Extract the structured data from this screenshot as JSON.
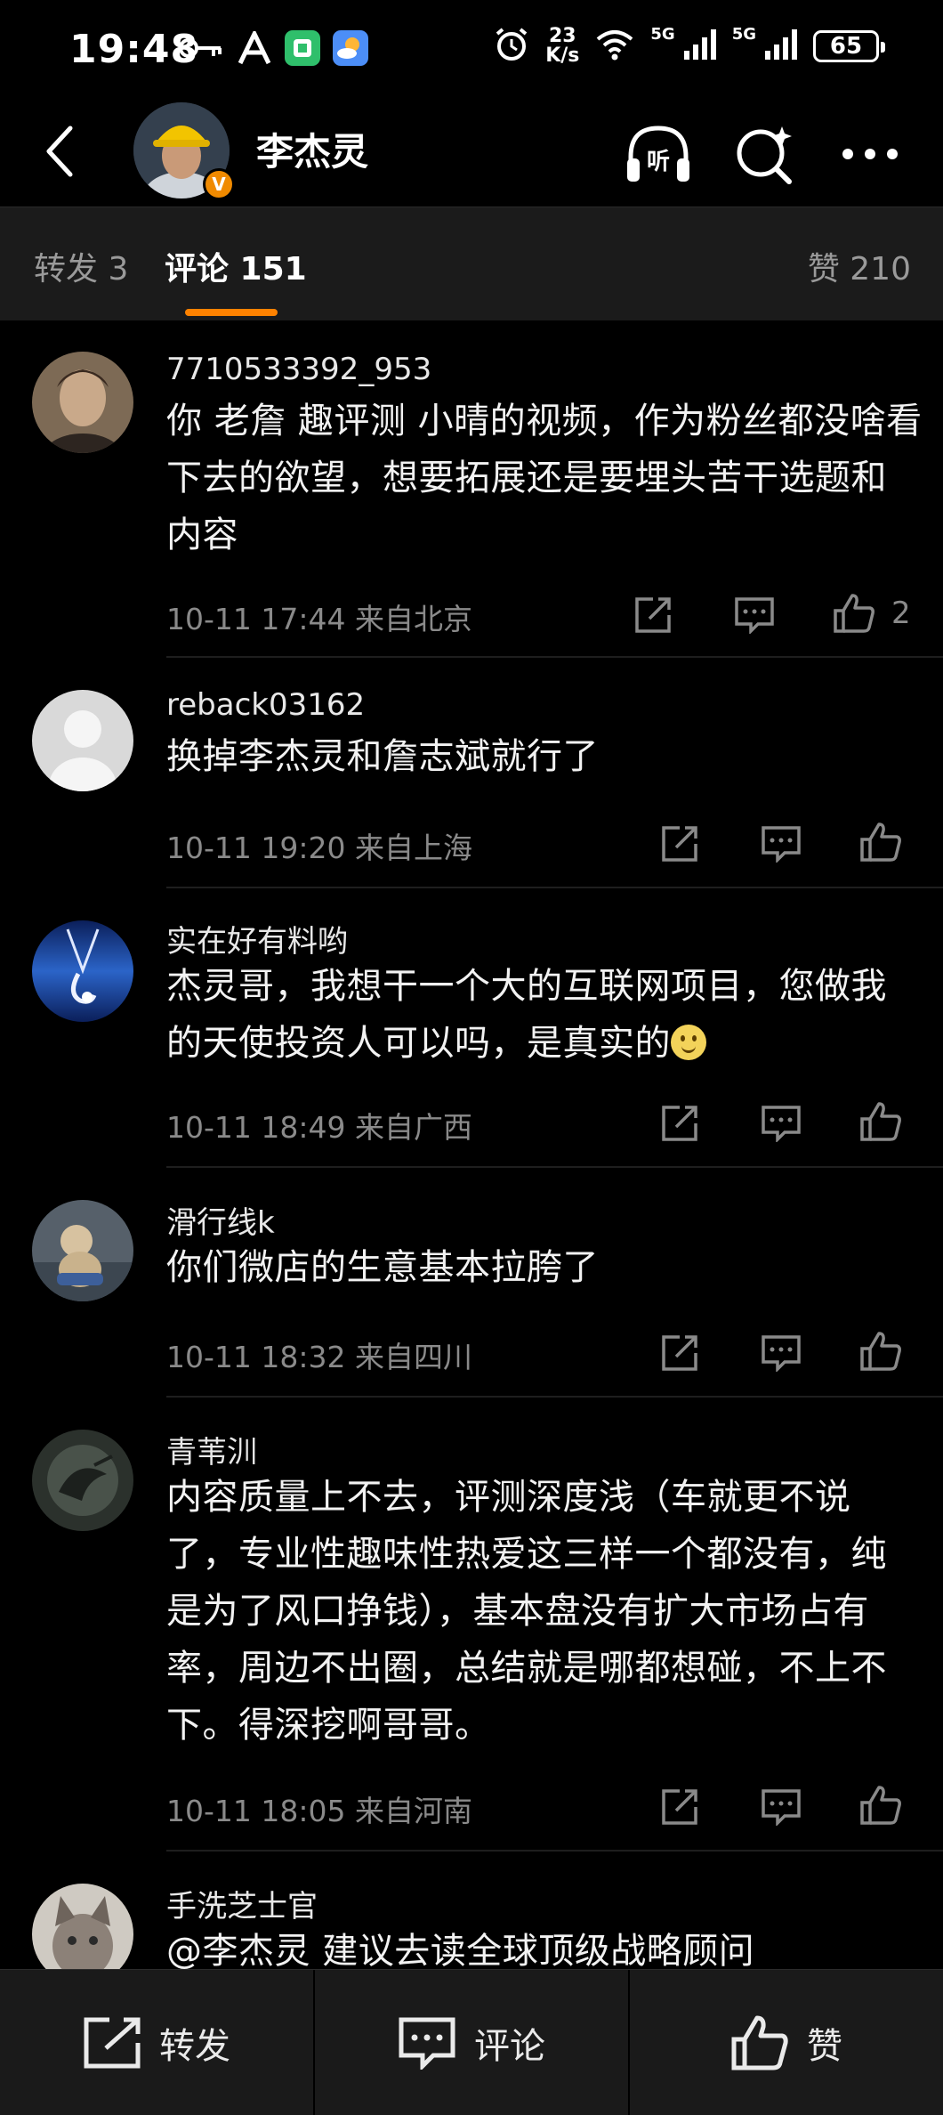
{
  "status_bar": {
    "time": "19:48",
    "net_speed_value": "23",
    "net_speed_unit": "K/s",
    "signal1_label": "5G",
    "signal2_label": "5G",
    "battery": "65"
  },
  "header": {
    "name": "李杰灵",
    "verified_badge": "V"
  },
  "tabs": {
    "repost": "转发 3",
    "comments": "评论 151",
    "likes": "赞 210"
  },
  "comments": [
    {
      "user": "7710533392_953",
      "text": "你 老詹 趣评测 小晴的视频，作为粉丝都没啥看下去的欲望，想要拓展还是要埋头苦干选题和内容",
      "time": "10-11 17:44",
      "location": "来自北京",
      "likes": "2"
    },
    {
      "user": "reback03162",
      "text": "换掉李杰灵和詹志斌就行了",
      "time": "10-11 19:20",
      "location": "来自上海",
      "likes": ""
    },
    {
      "user": "实在好有料哟",
      "text": "杰灵哥，我想干一个大的互联网项目，您做我的天使投资人可以吗，是真实的",
      "time": "10-11 18:49",
      "location": "来自广西",
      "likes": ""
    },
    {
      "user": "滑行线k",
      "text": "你们微店的生意基本拉胯了",
      "time": "10-11 18:32",
      "location": "来自四川",
      "likes": ""
    },
    {
      "user": "青苇汌",
      "text": "内容质量上不去，评测深度浅（车就更不说了，专业性趣味性热爱这三样一个都没有，纯是为了风口挣钱），基本盘没有扩大市场占有率，周边不出圈，总结就是哪都想碰，不上不下。得深挖啊哥哥。",
      "time": "10-11 18:05",
      "location": "来自河南",
      "likes": ""
    },
    {
      "user": "手洗芝士官",
      "text": "@李杰灵 建议去读全球顶级战略顾问",
      "time": "",
      "location": "",
      "likes": ""
    }
  ],
  "bottom_bar": {
    "repost": "转发",
    "comment": "评论",
    "like": "赞"
  },
  "colors": {
    "accent": "#ff8200",
    "background": "#000000",
    "muted_text": "#8a8a8a"
  },
  "icons": [
    "back-arrow-icon",
    "headphones-icon",
    "search-sparkle-icon",
    "more-icon",
    "share-icon",
    "comment-icon",
    "thumbs-up-icon"
  ]
}
